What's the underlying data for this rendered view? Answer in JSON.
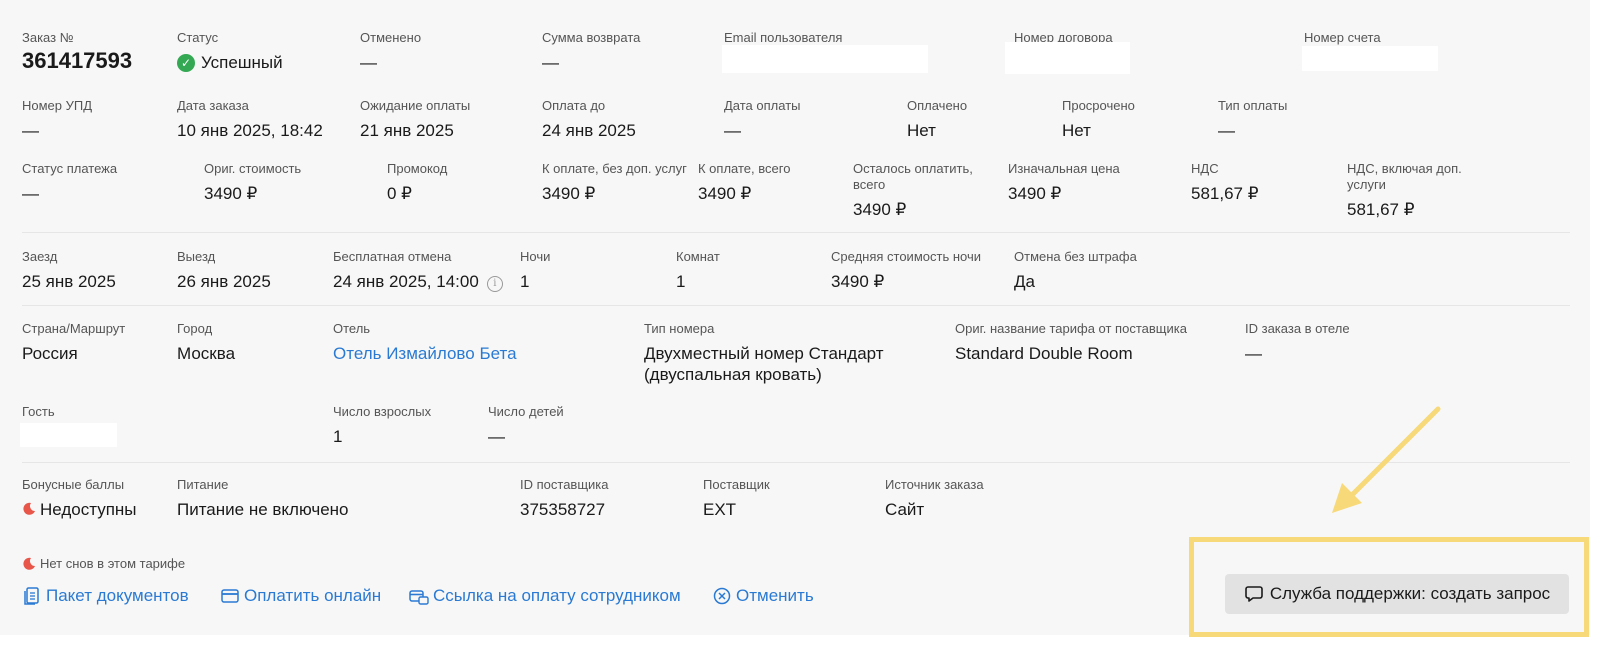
{
  "order": {
    "number_label": "Заказ №",
    "number": "361417593",
    "status_label": "Статус",
    "status": "Успешный",
    "cancelled_label": "Отменено",
    "cancelled": "—",
    "refund_label": "Сумма возврата",
    "refund": "—",
    "email_label": "Email пользователя",
    "contract_label": "Номер договора",
    "account_label": "Номер счета"
  },
  "payment": {
    "upd_label": "Номер УПД",
    "upd": "—",
    "order_date_label": "Дата заказа",
    "order_date": "10 янв 2025, 18:42",
    "awaiting_label": "Ожидание оплаты",
    "awaiting": "21 янв 2025",
    "pay_until_label": "Оплата до",
    "pay_until": "24 янв 2025",
    "pay_date_label": "Дата оплаты",
    "pay_date": "—",
    "paid_label": "Оплачено",
    "paid": "Нет",
    "overdue_label": "Просрочено",
    "overdue": "Нет",
    "pay_type_label": "Тип оплаты",
    "pay_type": "—"
  },
  "cost": {
    "pay_status_label": "Статус платежа",
    "pay_status": "—",
    "orig_cost_label": "Ориг. стоимость",
    "orig_cost": "3490 ₽",
    "promo_label": "Промокод",
    "promo": "0 ₽",
    "to_pay_no_extra_label": "К оплате, без доп. услуг",
    "to_pay_no_extra": "3490 ₽",
    "to_pay_total_label": "К оплате, всего",
    "to_pay_total": "3490 ₽",
    "remaining_label": "Осталось оплатить, всего",
    "remaining": "3490 ₽",
    "initial_price_label": "Изначальная цена",
    "initial_price": "3490 ₽",
    "vat_label": "НДС",
    "vat": "581,67 ₽",
    "vat_extra_label": "НДС, включая доп. услуги",
    "vat_extra": "581,67 ₽"
  },
  "stay": {
    "checkin_label": "Заезд",
    "checkin": "25 янв 2025",
    "checkout_label": "Выезд",
    "checkout": "26 янв 2025",
    "free_cancel_label": "Бесплатная отмена",
    "free_cancel": "24 янв 2025, 14:00",
    "nights_label": "Ночи",
    "nights": "1",
    "rooms_label": "Комнат",
    "rooms": "1",
    "avg_night_label": "Средняя стоимость ночи",
    "avg_night": "3490 ₽",
    "no_penalty_label": "Отмена без штрафа",
    "no_penalty": "Да"
  },
  "hotel": {
    "country_label": "Страна/Маршрут",
    "country": "Россия",
    "city_label": "Город",
    "city": "Москва",
    "hotel_label": "Отель",
    "hotel": "Отель Измайлово Бета",
    "room_type_label": "Тип номера",
    "room_type": "Двухместный номер Стандарт (двуспальная кровать)",
    "tariff_label": "Ориг. название тарифа от поставщика",
    "tariff": "Standard Double Room",
    "hotel_order_id_label": "ID заказа в отеле",
    "hotel_order_id": "—"
  },
  "guests": {
    "guest_label": "Гость",
    "adults_label": "Число взрослых",
    "adults": "1",
    "children_label": "Число детей",
    "children": "—"
  },
  "extra": {
    "bonus_label": "Бонусные баллы",
    "bonus": "Недоступны",
    "meal_label": "Питание",
    "meal": "Питание не включено",
    "supplier_id_label": "ID поставщика",
    "supplier_id": "375358727",
    "supplier_label": "Поставщик",
    "supplier": "EXT",
    "source_label": "Источник заказа",
    "source": "Сайт"
  },
  "note": "Нет снов в этом тарифе",
  "actions": {
    "documents": "Пакет документов",
    "pay_online": "Оплатить онлайн",
    "pay_link": "Ссылка на оплату сотрудником",
    "cancel": "Отменить"
  },
  "support_button": "Служба поддержки: создать запрос",
  "icons": [
    "check-circle-icon",
    "info-icon",
    "moon-icon",
    "document-icon",
    "card-icon",
    "card-link-icon",
    "cancel-circle-icon",
    "chat-icon",
    "arrow-icon"
  ],
  "colors": {
    "link": "#2a7ad3",
    "success": "#34a853",
    "highlight": "#f7d97a",
    "warning": "#e8564a"
  }
}
